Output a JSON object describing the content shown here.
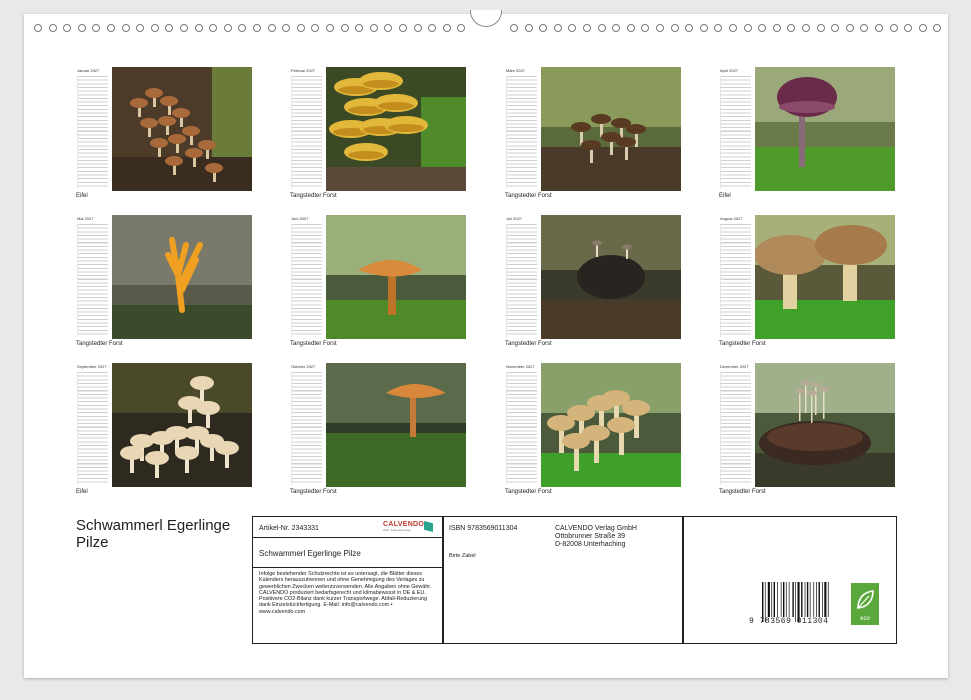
{
  "months": [
    {
      "name": "Januar 2027",
      "caption": "Eifel",
      "scene": "cluster-wood"
    },
    {
      "name": "Februar 2027",
      "caption": "Tangstedter Forst",
      "scene": "yellow-shelf"
    },
    {
      "name": "März 2027",
      "caption": "Tangstedter Forst",
      "scene": "small-brown"
    },
    {
      "name": "April 2027",
      "caption": "Eifel",
      "scene": "purple-cap"
    },
    {
      "name": "Mai 2027",
      "caption": "Tangstedter Forst",
      "scene": "coral-orange"
    },
    {
      "name": "Juni 2027",
      "caption": "Tangstedter Forst",
      "scene": "orange-funnel"
    },
    {
      "name": "Juli 2027",
      "caption": "Tangstedter Forst",
      "scene": "dark-cone"
    },
    {
      "name": "August 2027",
      "caption": "Tangstedter Forst",
      "scene": "two-caps"
    },
    {
      "name": "September 2027",
      "caption": "Eifel",
      "scene": "white-cluster"
    },
    {
      "name": "Oktober 2027",
      "caption": "Tangstedter Forst",
      "scene": "orange-single"
    },
    {
      "name": "November 2027",
      "caption": "Tangstedter Forst",
      "scene": "pale-group"
    },
    {
      "name": "Dezember 2027",
      "caption": "Tangstedter Forst",
      "scene": "cone-tiny"
    }
  ],
  "cover": {
    "title": "Schwammerl Egerlinge Pilze"
  },
  "info": {
    "article_label": "Artikel-Nr. 2343331",
    "product_title": "Schwammerl Egerlinge Pilze",
    "legal_text": "Infolge bestehender Schutzrechte ist es untersagt, die Blätter dieses Kalenders herauszutrennen und ohne Genehmigung des Verlages zu gewerblichen Zwecken weiterzuverwenden. Alle Angaben ohne Gewähr. CALVENDO produziert bedarfsgerecht und klimabewusst in DE & EU. Positivere CO2-Bilanz dank kurzer Transportwege. Abfall-Reduzierung dank Einzelstückfertigung. E-Mail: info@calvendo.com • www.calvendo.com",
    "isbn": "ISBN 9783569011304",
    "publisher_line1": "CALVENDO Verlag GmbH",
    "publisher_line2": "Ottobrunner Straße 39",
    "publisher_line3": "D-82008 Unterhaching",
    "author": "Birte Zabel",
    "logo_word": "CALVENDO",
    "logo_tagline": "Welt. Kalenderverlag",
    "barcode_number": "9 783569 011304",
    "eco_label": "eco"
  },
  "colors": {
    "eco_green": "#5aa83c",
    "calvendo_red": "#c0392b",
    "calvendo_teal": "#2aa58f"
  }
}
